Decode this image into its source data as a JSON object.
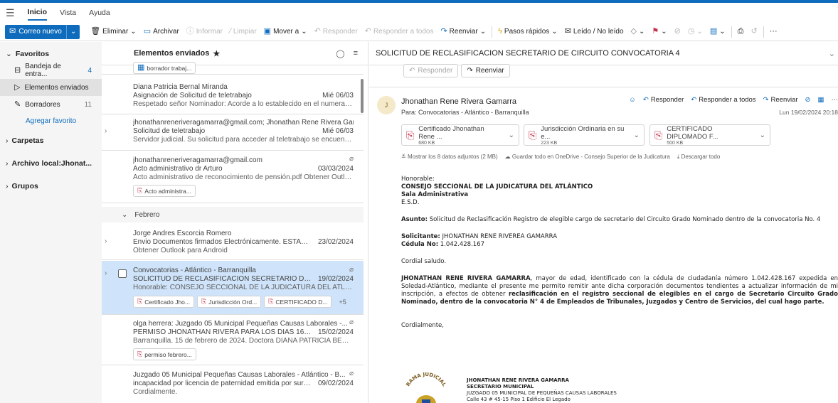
{
  "menu": {
    "tabs": [
      "Inicio",
      "Vista",
      "Ayuda"
    ]
  },
  "ribbon": {
    "new_mail": "Correo nuevo",
    "delete": "Eliminar",
    "archive": "Archivar",
    "report": "Informar",
    "clean": "Limpiar",
    "move": "Mover a",
    "reply": "Responder",
    "reply_all": "Responder a todos",
    "forward": "Reenviar",
    "quick_steps": "Pasos rápidos",
    "read_unread": "Leído / No leído"
  },
  "folders": {
    "favorites_label": "Favoritos",
    "items": [
      {
        "label": "Bandeja de entra...",
        "count": "4"
      },
      {
        "label": "Elementos enviados",
        "count": ""
      },
      {
        "label": "Borradores",
        "count": "11"
      }
    ],
    "add_favorite": "Agregar favorito",
    "sections": [
      "Carpetas",
      "Archivo local:Jhonat...",
      "Grupos"
    ]
  },
  "list": {
    "title": "Elementos enviados",
    "top_chip": "borrador trabaj...",
    "group_february": "Febrero",
    "messages": [
      {
        "from": "Diana Patricia Bernal Miranda",
        "subject": "Asignación de Solicitud de teletrabajo",
        "date": "Mié 06/03",
        "preview": "Respetado señor Nominador: Acorde a lo establecido en el numeral 1 ..."
      },
      {
        "from": "jhonathanreneriveragamarra@gmail.com; Jhonathan Rene Rivera Gam...",
        "subject": "Solicitud de teletrabajo",
        "date": "Mié 06/03",
        "preview": "Servidor judicial. Su solicitud para acceder al teletrabajo se encuentra ..."
      },
      {
        "from": "jhonathanreneriveragamarra@gmail.com",
        "subject": "Acto administrativo dr Arturo",
        "date": "03/03/2024",
        "preview": "Acto administrativo de reconocimiento de pensión.pdf Obtener Outlo...",
        "chips": [
          "Acto administra..."
        ]
      },
      {
        "from": "Jorge Andres Escorcia Romero",
        "subject": "Envio Documentos firmados Electrónicamente. ESTADO P...",
        "date": "23/02/2024",
        "preview": "Obtener Outlook para Android"
      },
      {
        "from": "Convocatorias - Atlántico - Barranquilla",
        "subject": "SOLICITUD DE RECLASIFICACION SECRETARIO DE CIRCUI...",
        "date": "19/02/2024",
        "preview": "Honorable: CONSEJO SECCIONAL DE LA JUDICATURA DEL ATLÁNTICO...",
        "chips": [
          "Certificado Jho...",
          "Jurisdicción Ord...",
          "CERTIFICADO D..."
        ],
        "more": "+5"
      },
      {
        "from": "olga herrera: Juzgado 05 Municipal Pequeñas Causas Laborales -...",
        "subject": "PERMISO JHONATHAN RIVERA PARA LOS DIAS 16, 19 Y 2...",
        "date": "15/02/2024",
        "preview": "Barranquilla. 15 de febrero de 2024. Doctora DIANA PATRICIA BERNAL...",
        "chips": [
          "permiso febrero..."
        ]
      },
      {
        "from": "Juzgado 05 Municipal Pequeñas Causas Laborales - Atlántico - B...",
        "subject": "incapacidad por licencia de paternidad emitida por sura e...",
        "date": "09/02/2024",
        "preview": "Cordialmente."
      }
    ]
  },
  "reading": {
    "subject": "SOLICITUD DE RECLASIFICACION SECRETARIO DE CIRCUITO CONVOCATORIA 4",
    "reply": "Responder",
    "forward": "Reenviar",
    "reply_all": "Responder a todos",
    "avatar": "J",
    "sender": "Jhonathan Rene Rivera Gamarra",
    "to": "Para:  Convocatorias - Atlántico - Barranquilla",
    "date": "Lun 19/02/2024 20:18",
    "attachments": [
      {
        "name": "Certificado Jhonathan Rene ...",
        "size": "680 KB"
      },
      {
        "name": "Jurisdicción Ordinaria en su e...",
        "size": "223 KB"
      },
      {
        "name": "CERTIFICADO DIPLOMADO F...",
        "size": "500 KB"
      }
    ],
    "show_all": "Mostrar los 8 datos adjuntos (2 MB)",
    "save_onedrive": "Guardar todo en OneDrive - Consejo Superior de la Judicatura",
    "download_all": "Descargar todo",
    "body": {
      "greeting": "Honorable:",
      "org1": "CONSEJO SECCIONAL DE LA JUDICATURA DEL ATLÁNTICO",
      "org2": "Sala Administrativa",
      "esd": "E.S.D.",
      "asunto_label": "Asunto:",
      "asunto": " Solicitud de Reclasificación Registro de elegible cargo de secretario del Circuito Grado Nominado dentro de la convocatoria No. 4",
      "solicitante_label": "Solicitante:",
      "solicitante": " JHONATHAN RENE RIVEREA GAMARRA",
      "cedula_label": "Cédula No:",
      "cedula": " 1.042.428.167",
      "saludo": "Cordial saludo.",
      "p_name": "JHONATHAN RENE RIVERA GAMARRA",
      "p_text1": ", mayor de edad, identificado con la cédula de ciudadanía número 1.042.428.167 expedida en Soledad-Atlántico, mediante el presente me permito remitir ante dicha corporación documentos tendientes a actualizar información de mi inscripción, a efectos de obtener ",
      "p_bold2": "reclasificación en el registro seccional de elegibles en el cargo de Secretario Circuito Grado Nominado, dentro de la convocatoria  N° 4 de Empleados de Tribunales, Juzgados y Centro de Servicios, del cual hago parte.",
      "closing": "Cordialmente,"
    },
    "signature": {
      "seal_text": "RAMA JUDICIAL",
      "name": "JHONATHAN RENE RIVERA GAMARRA",
      "role": "SECRETARIO MUNICIPAL",
      "court": "JUZGADO 05 MUNICIPAL DE PEQUEÑAS CAUSAS LABORALES",
      "address": "Calle 43 # 45-15 Piso 1 Edificio El Legado"
    }
  },
  "colors": {
    "accent": "#0f6cbd",
    "selected": "#cfe4fa",
    "pdf": "#c4314b"
  }
}
